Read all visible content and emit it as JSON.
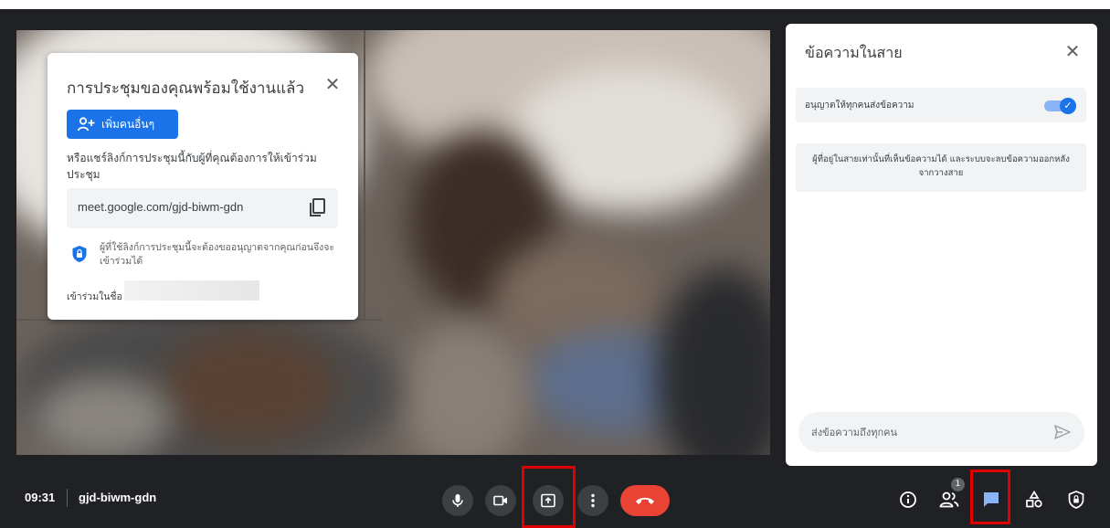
{
  "info_card": {
    "title": "การประชุมของคุณพร้อมใช้งานแล้ว",
    "add_button_label": "เพิ่มคนอื่นๆ",
    "share_text": "หรือแชร์ลิงก์การประชุมนี้กับผู้ที่คุณต้องการให้เข้าร่วมประชุม",
    "meeting_link": "meet.google.com/gjd-biwm-gdn",
    "security_note": "ผู้ที่ใช้ลิงก์การประชุมนี้จะต้องขออนุญาตจากคุณก่อนจึงจะเข้าร่วมได้",
    "joined_as_label": "เข้าร่วมในชื่อ"
  },
  "chat_panel": {
    "title": "ข้อความในสาย",
    "allow_messages_label": "อนุญาตให้ทุกคนส่งข้อความ",
    "allow_messages_enabled": true,
    "notice": "ผู้ที่อยู่ในสายเท่านั้นที่เห็นข้อความได้ และระบบจะลบข้อความออกหลังจากวางสาย",
    "input_placeholder": "ส่งข้อความถึงทุกคน"
  },
  "bottom_bar": {
    "time": "09:31",
    "meeting_code": "gjd-biwm-gdn",
    "people_count": "1",
    "controls": [
      "mic-icon",
      "camera-icon",
      "present-screen-icon",
      "more-options-icon",
      "end-call-icon"
    ],
    "right_controls": [
      "info-icon",
      "people-icon",
      "chat-icon",
      "activities-icon",
      "host-controls-icon"
    ]
  },
  "colors": {
    "accent": "#1a73e8",
    "end_call": "#ea4335",
    "bar_bg": "#202124",
    "highlight": "#e00000"
  }
}
